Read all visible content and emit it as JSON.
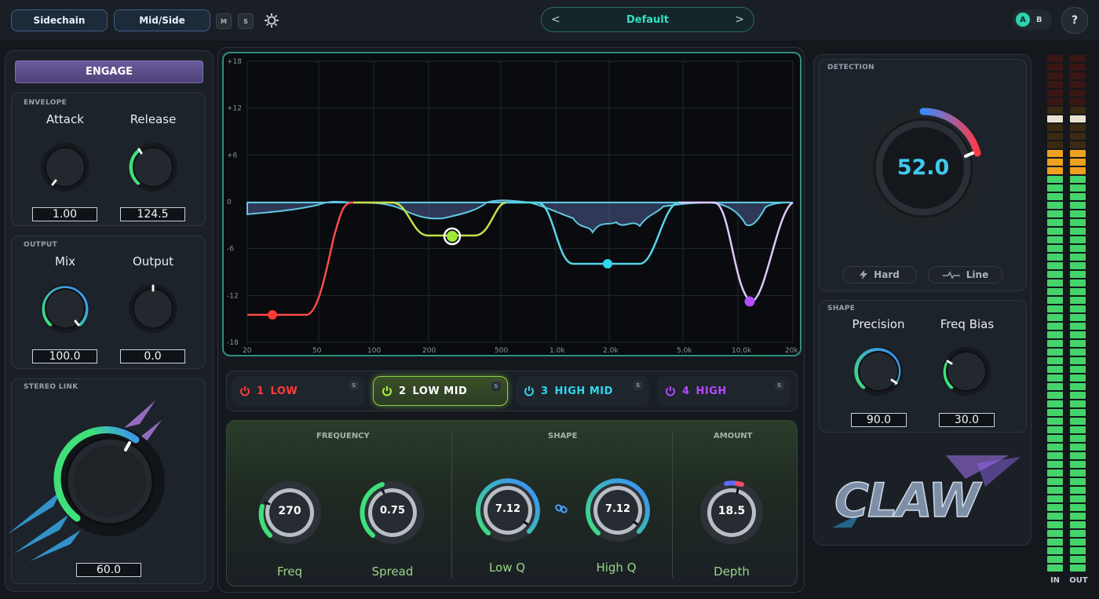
{
  "topbar": {
    "sidechain_label": "Sidechain",
    "midside_label": "Mid/Side",
    "m_label": "M",
    "s_label": "S",
    "settings_icon": "gear-icon",
    "preset_prev": "<",
    "preset_name": "Default",
    "preset_next": ">",
    "ab_a": "A",
    "ab_b": "B",
    "help_label": "?"
  },
  "left": {
    "engage_label": "ENGAGE",
    "envelope_caption": "ENVELOPE",
    "attack_label": "Attack",
    "attack_value": "1.00",
    "release_label": "Release",
    "release_value": "124.5",
    "output_caption": "OUTPUT",
    "mix_label": "Mix",
    "mix_value": "100.0",
    "output_label": "Output",
    "output_value": "0.0",
    "stereo_caption": "STEREO LINK",
    "stereo_value": "60.0"
  },
  "graph": {
    "y_ticks": [
      "+18",
      "+12",
      "+6",
      "0",
      "-6",
      "-12",
      "-18"
    ],
    "x_ticks": [
      "20",
      "50",
      "100",
      "200",
      "500",
      "1.0k",
      "2.0k",
      "5.0k",
      "10.0k",
      "20k"
    ]
  },
  "bands": [
    {
      "num": "1",
      "name": "LOW",
      "color": "#ff3b3b",
      "solo": "S"
    },
    {
      "num": "2",
      "name": "LOW MID",
      "color": "#aef24a",
      "solo": "S"
    },
    {
      "num": "3",
      "name": "HIGH MID",
      "color": "#2fd7ee",
      "solo": "S"
    },
    {
      "num": "4",
      "name": "HIGH",
      "color": "#b14cff",
      "solo": "S"
    }
  ],
  "params": {
    "frequency_caption": "FREQUENCY",
    "shape_caption": "SHAPE",
    "amount_caption": "AMOUNT",
    "freq_value": "270",
    "freq_label": "Freq",
    "spread_value": "0.75",
    "spread_label": "Spread",
    "lowq_value": "7.12",
    "lowq_label": "Low Q",
    "highq_value": "7.12",
    "highq_label": "High Q",
    "depth_value": "18.5",
    "depth_label": "Depth"
  },
  "right": {
    "detection_caption": "DETECTION",
    "detection_value": "52.0",
    "hard_label": "Hard",
    "line_label": "Line",
    "shape_caption": "SHAPE",
    "precision_label": "Precision",
    "precision_value": "90.0",
    "freqbias_label": "Freq Bias",
    "freqbias_value": "30.0",
    "logo_text": "CLAW"
  },
  "meters": {
    "in_label": "IN",
    "out_label": "OUT"
  }
}
